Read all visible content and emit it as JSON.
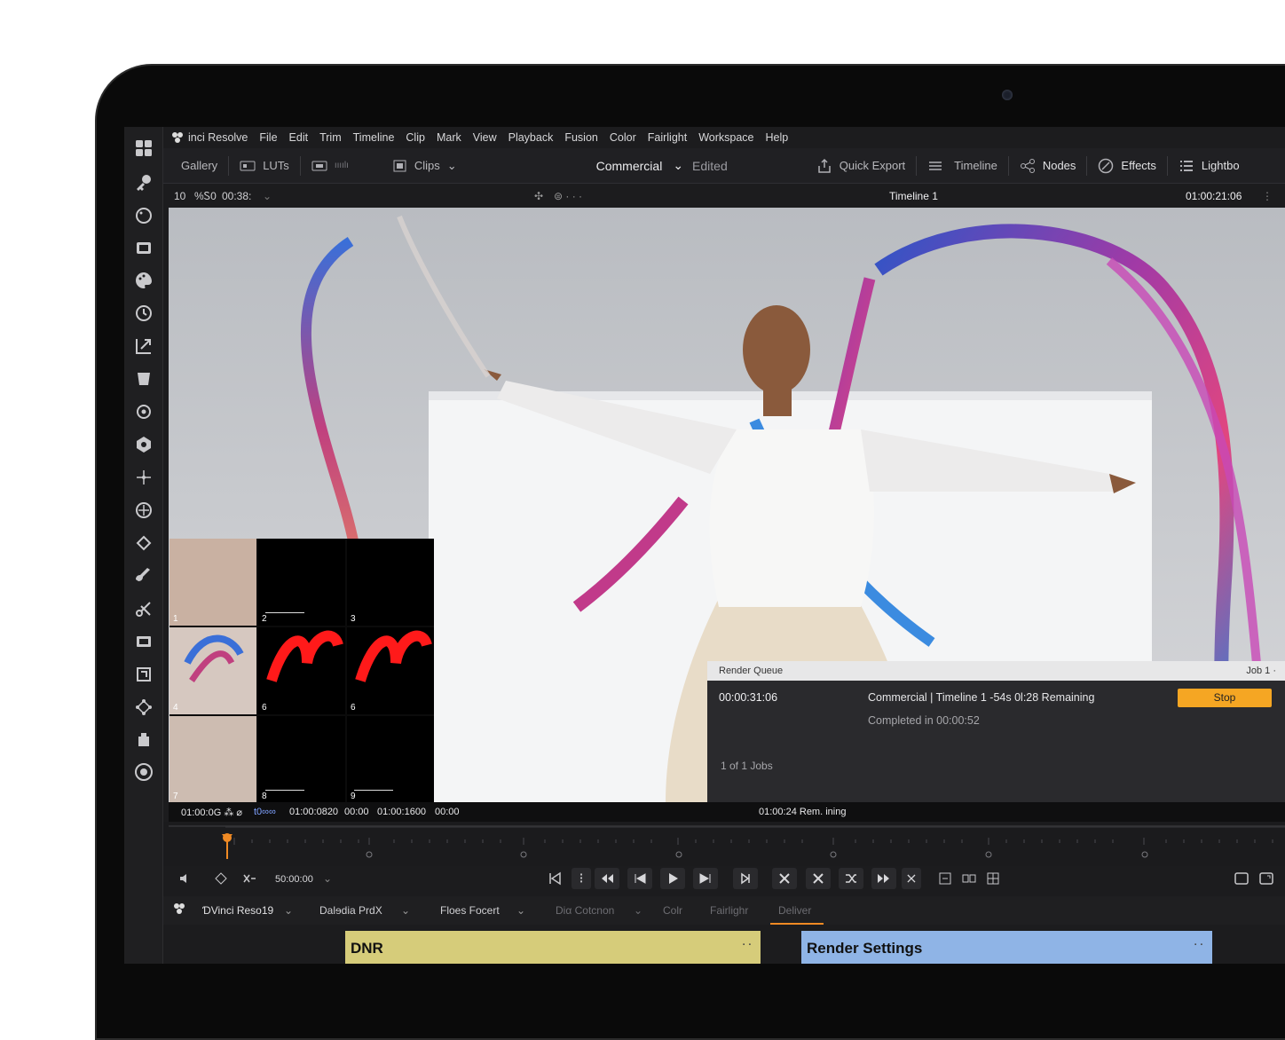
{
  "app": {
    "menu": [
      "File",
      "Edit",
      "Trim",
      "Timeline",
      "Clip",
      "Mark",
      "View",
      "Playback",
      "Fusion",
      "Color",
      "Fairlight",
      "Workspace",
      "Help"
    ],
    "title": "inci Resolve"
  },
  "toolbar": {
    "gallery": "Gallery",
    "luts": "LUTs",
    "clips": "Clips",
    "project": "Commercial",
    "status": "Edited",
    "quick_export": "Quick Export",
    "timeline": "Timeline",
    "nodes": "Nodes",
    "effects": "Effects",
    "lightbox": "Lightbo"
  },
  "viewer_header": {
    "zoom": "10",
    "percent": "%Ꮪ0",
    "tc_left": "00:38:",
    "timeline_name": "Timeline 1",
    "timecode": "01:00:21:06"
  },
  "thumbnails": [
    "1",
    "2",
    "3",
    "4",
    "6",
    "6",
    "7",
    "8",
    "9"
  ],
  "render_queue": {
    "title": "Render Queue",
    "job_label": "Job 1 ·",
    "elapsed": "00:00:31:06",
    "job_name": "Commercial | Timeline 1 -54s  0l:28 Remaining",
    "completed": "Completed in 00:00:52",
    "jobs_count": "1 of 1 Jobs",
    "stop_label": "Stop"
  },
  "timecode_strip": {
    "tc1": "01:00:0G ⁂ ⌀",
    "tc2": "t0∞∞",
    "tc3": "01:00:0820",
    "tc4": "00:00",
    "tc5": "01:00:1600",
    "tc6": "00:00",
    "remaining": "01:00:24 Rem. ining"
  },
  "transport": {
    "timecode": "50:00:00"
  },
  "page_tabs": {
    "brand": "ƊVinci Reso19",
    "media": "Dalɘdia PrdX",
    "fusion": "Floes  Focert",
    "color": "Diα  Cotcnon",
    "col2": "Colr",
    "fairlight": "Fairlighr",
    "deliver": "Deliver"
  },
  "panels": {
    "left_title": "DNR",
    "right_title": "Render Settings"
  },
  "colors": {
    "accent": "#f5a623",
    "panel_yellow": "#d6cc7a",
    "panel_blue": "#8fb4e6"
  }
}
